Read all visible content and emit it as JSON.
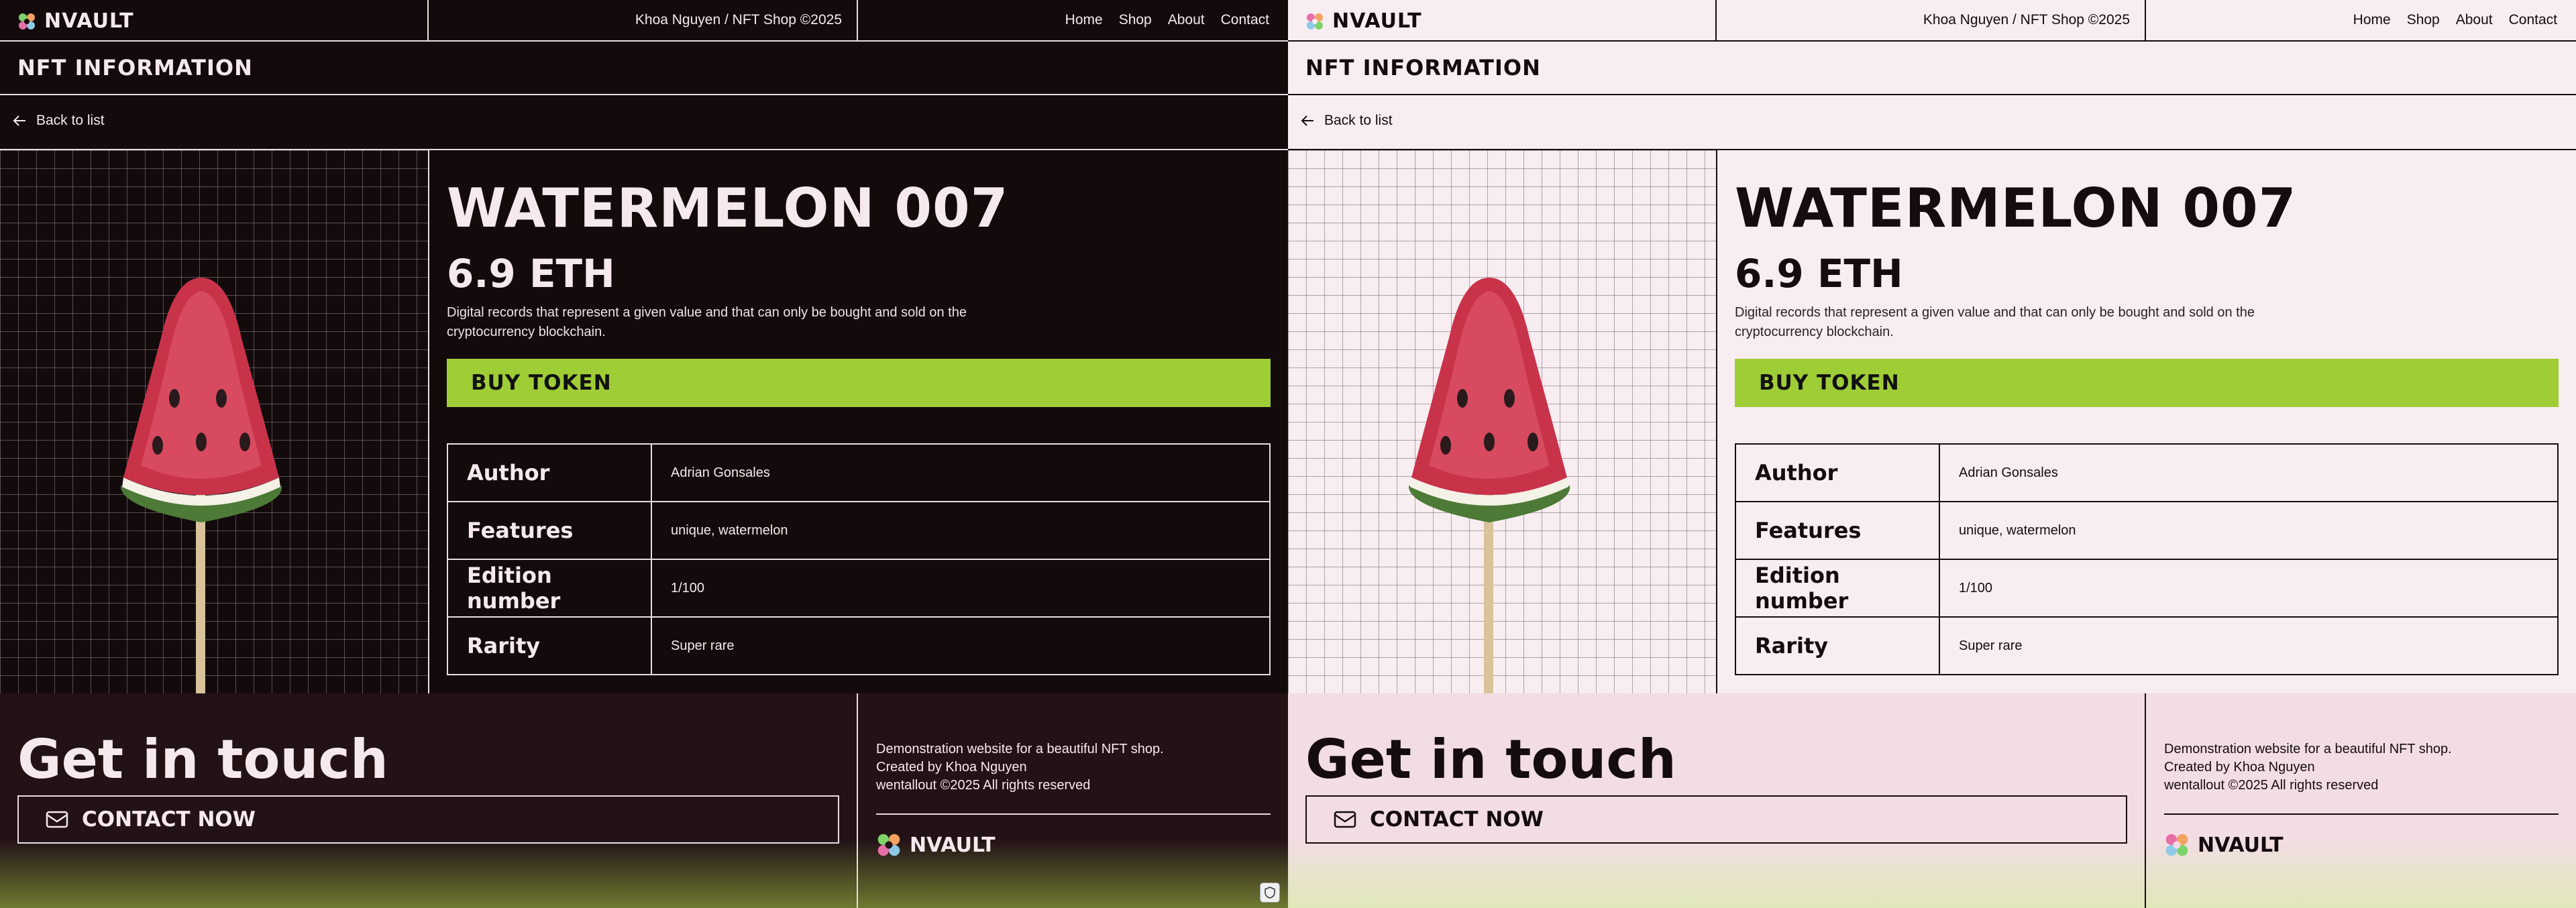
{
  "brand": "NVAULT",
  "credit": "Khoa Nguyen / NFT Shop ©2025",
  "nav": [
    "Home",
    "Shop",
    "About",
    "Contact"
  ],
  "section_title": "NFT INFORMATION",
  "back_label": "Back to list",
  "product": {
    "name": "WATERMELON 007",
    "price": "6.9 ETH",
    "description": "Digital records that represent a given value and that can only be bought and sold on the cryptocurrency blockchain.",
    "buy_label": "BUY TOKEN",
    "specs": [
      {
        "key": "Author",
        "value": "Adrian Gonsales"
      },
      {
        "key": "Features",
        "value": "unique, watermelon"
      },
      {
        "key": "Edition number",
        "value": "1/100"
      },
      {
        "key": "Rarity",
        "value": "Super rare"
      }
    ]
  },
  "footer": {
    "heading": "Get in touch",
    "cta": "CONTACT NOW",
    "about": [
      "Demonstration website for a beautiful NFT shop.",
      "Created by Khoa Nguyen",
      "wentallout ©2025 All rights reserved"
    ]
  },
  "colors": {
    "accent": "#9fcd36",
    "dark_bg": "#130a0c",
    "light_bg": "#f8edf1"
  },
  "icons": [
    "logo-icon",
    "arrow-left-icon",
    "mail-icon",
    "shield-icon"
  ]
}
